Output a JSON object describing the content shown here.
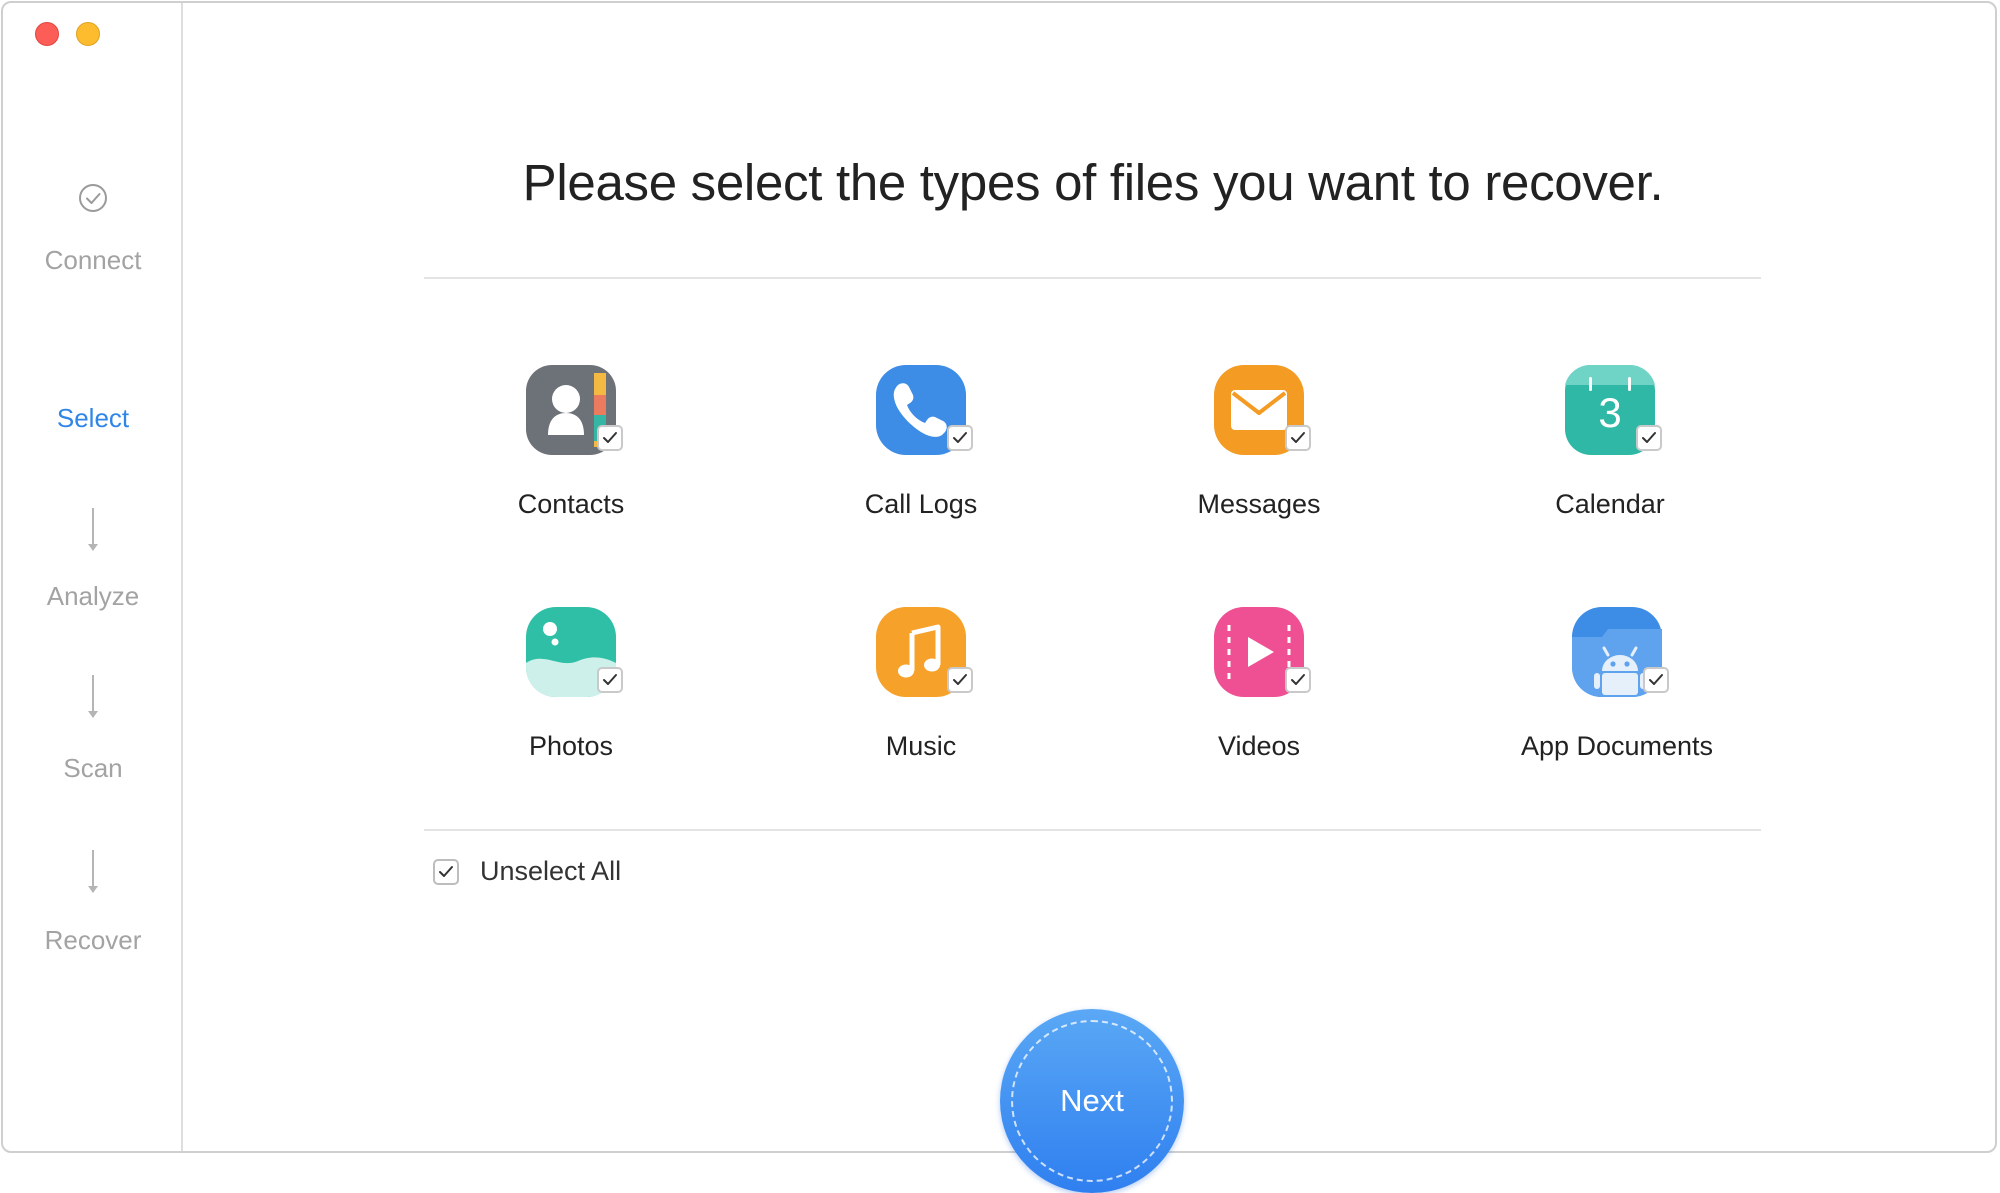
{
  "colors": {
    "accent": "#2f86e6",
    "close_button": "#fc5d56",
    "minimize_button": "#fdbc2e",
    "inactive_step": "#a3a3a3",
    "next_gradient_top": "#5aa8f5",
    "next_gradient_bottom": "#2f7ff0"
  },
  "sidebar": {
    "steps": [
      {
        "label": "Connect",
        "icon": "check-circle-icon",
        "state": "done"
      },
      {
        "label": "Select",
        "icon": "",
        "state": "active"
      },
      {
        "label": "Analyze",
        "icon": "down-arrow-icon",
        "state": "pending"
      },
      {
        "label": "Scan",
        "icon": "down-arrow-icon",
        "state": "pending"
      },
      {
        "label": "Recover",
        "icon": "down-arrow-icon",
        "state": "pending"
      }
    ]
  },
  "main": {
    "title": "Please select the types of files you want to recover.",
    "file_types": [
      {
        "label": "Contacts",
        "icon": "contacts-icon",
        "checked": true
      },
      {
        "label": "Call Logs",
        "icon": "phone-icon",
        "checked": true
      },
      {
        "label": "Messages",
        "icon": "envelope-icon",
        "checked": true
      },
      {
        "label": "Calendar",
        "icon": "calendar-icon",
        "icon_text": "3",
        "checked": true
      },
      {
        "label": "Photos",
        "icon": "photos-icon",
        "checked": true
      },
      {
        "label": "Music",
        "icon": "music-note-icon",
        "checked": true
      },
      {
        "label": "Videos",
        "icon": "play-icon",
        "checked": true
      },
      {
        "label": "App Documents",
        "icon": "android-folder-icon",
        "checked": true
      }
    ],
    "unselect_all": {
      "label": "Unselect All",
      "checked": true
    },
    "next_label": "Next"
  }
}
